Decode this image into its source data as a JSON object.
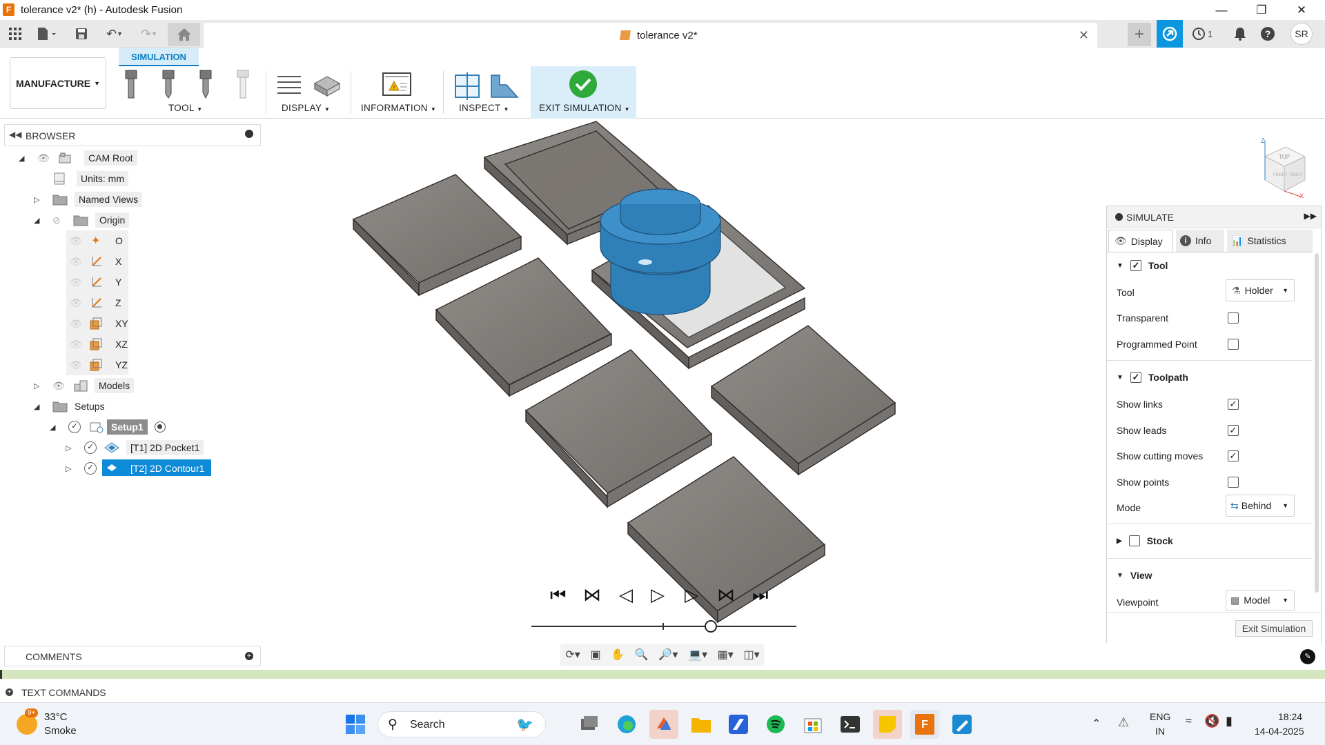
{
  "window": {
    "title": "tolerance v2* (h) - Autodesk Fusion",
    "app_icon_letter": "F"
  },
  "doc_tab": {
    "name": "tolerance v2*"
  },
  "user": {
    "initials": "SR",
    "jobs_count": "1"
  },
  "ribbon": {
    "workspace": "MANUFACTURE",
    "active_tab": "SIMULATION",
    "groups": [
      "TOOL",
      "DISPLAY",
      "INFORMATION",
      "INSPECT",
      "EXIT SIMULATION"
    ]
  },
  "browser": {
    "title": "BROWSER",
    "items": [
      {
        "label": "CAM Root"
      },
      {
        "label": "Units: mm"
      },
      {
        "label": "Named Views"
      },
      {
        "label": "Origin"
      },
      {
        "label": "O"
      },
      {
        "label": "X"
      },
      {
        "label": "Y"
      },
      {
        "label": "Z"
      },
      {
        "label": "XY"
      },
      {
        "label": "XZ"
      },
      {
        "label": "YZ"
      },
      {
        "label": "Models"
      },
      {
        "label": "Setups"
      },
      {
        "label": "Setup1"
      },
      {
        "label": "[T1] 2D Pocket1"
      },
      {
        "label": "[T2] 2D Contour1"
      }
    ]
  },
  "comments": {
    "title": "COMMENTS"
  },
  "text_commands": {
    "title": "TEXT COMMANDS"
  },
  "simulate": {
    "title": "SIMULATE",
    "tabs": [
      "Display",
      "Info",
      "Statistics"
    ],
    "tool_section": {
      "label": "Tool",
      "checked": true
    },
    "tool_label": "Tool",
    "tool_value": "Holder",
    "transparent_label": "Transparent",
    "programmed_point_label": "Programmed Point",
    "toolpath_section": {
      "label": "Toolpath",
      "checked": true
    },
    "show_links_label": "Show links",
    "show_leads_label": "Show leads",
    "show_cutting_label": "Show cutting moves",
    "show_points_label": "Show points",
    "mode_label": "Mode",
    "mode_value": "Behind",
    "stock_section": {
      "label": "Stock",
      "checked": false
    },
    "view_section": {
      "label": "View"
    },
    "viewpoint_label": "Viewpoint",
    "viewpoint_value": "Model",
    "exit_button": "Exit Simulation"
  },
  "playback": {
    "progress": 0.8
  },
  "taskbar": {
    "weather_temp": "33°C",
    "weather_desc": "Smoke",
    "weather_badge": "9+",
    "search_label": "Search",
    "lang": "ENG",
    "region": "IN",
    "time": "18:24",
    "date": "14-04-2025"
  },
  "colors": {
    "accent": "#0d7ec4",
    "tool_blue": "#2f7fb8",
    "check_green": "#2eaa3c",
    "selection": "#0d8bd9"
  }
}
